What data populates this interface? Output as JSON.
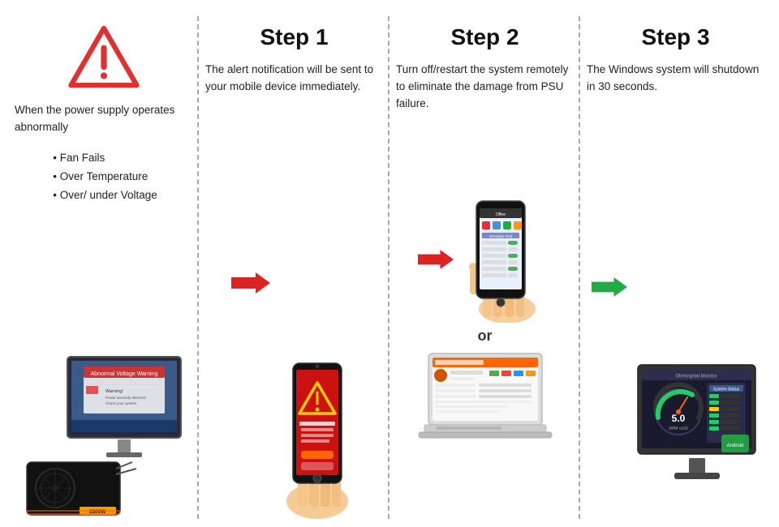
{
  "column0": {
    "description": "When the power supply operates abnormally",
    "bullets": [
      "Fan Fails",
      "Over Temperature",
      "Over/ under Voltage"
    ]
  },
  "column1": {
    "step": "Step 1",
    "description": "The alert notification will be sent to your mobile device immediately."
  },
  "column2": {
    "step": "Step 2",
    "description": "Turn off/restart the system remotely to eliminate the damage from PSU failure.",
    "or_text": "or"
  },
  "column3": {
    "step": "Step 3",
    "description": "The Windows system will shutdown in 30 seconds."
  }
}
